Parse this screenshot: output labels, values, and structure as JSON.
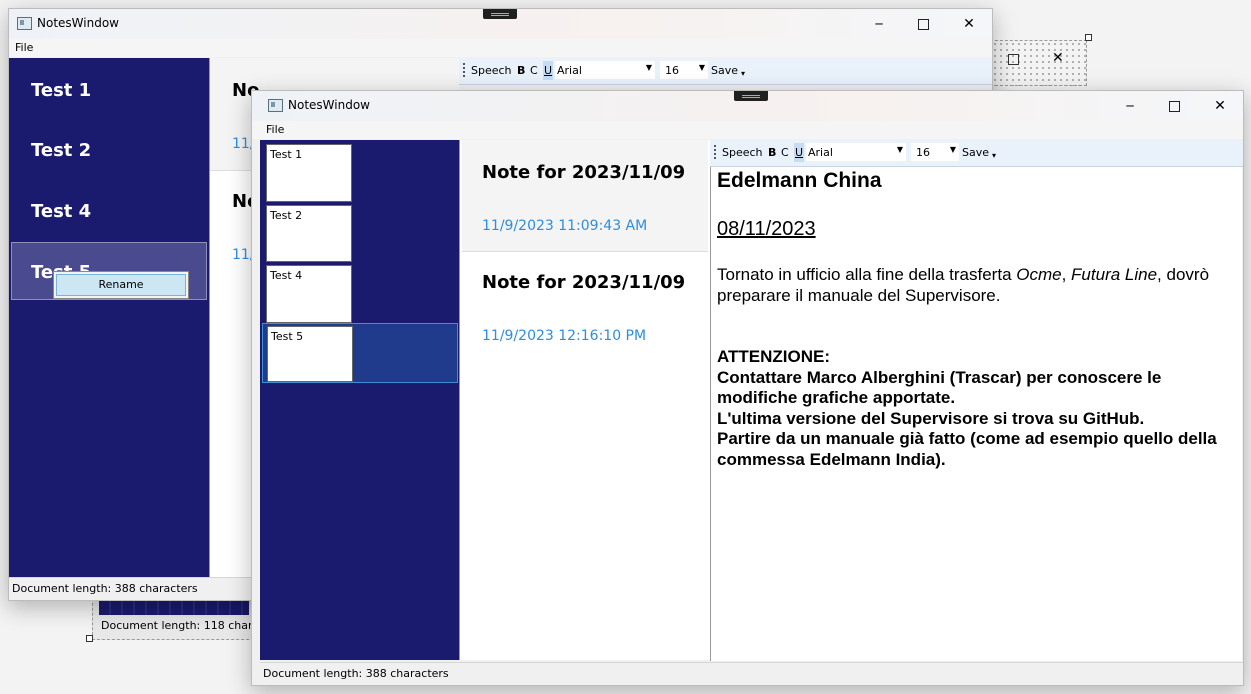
{
  "back_window": {
    "title": "NotesWindow",
    "menu": "File",
    "sidebar_items": [
      "Test 1",
      "Test 2",
      "Test 4",
      "Test 5"
    ],
    "context_menu_item": "Rename",
    "note_title_partial": "No",
    "note_date_partial": "11/",
    "status": "Document length: 388 characters",
    "toolbar": {
      "speech": "Speech",
      "bold": "B",
      "c": "C",
      "underline": "U",
      "font": "Arial",
      "size": "16",
      "save": "Save"
    },
    "behind_status": "Document length: 118 chara"
  },
  "front_window": {
    "title": "NotesWindow",
    "menu": "File",
    "thumbnails": [
      "Test 1",
      "Test 2",
      "Test 4",
      "Test 5"
    ],
    "selected_thumbnail": "Test 5",
    "notes": [
      {
        "title": "Note for 2023/11/09",
        "date": "11/9/2023 11:09:43 AM"
      },
      {
        "title": "Note for 2023/11/09",
        "date": "11/9/2023 12:16:10 PM"
      }
    ],
    "toolbar": {
      "speech": "Speech",
      "bold": "B",
      "c": "C",
      "underline": "U",
      "font": "Arial",
      "size": "16",
      "save": "Save"
    },
    "document": {
      "heading": "Edelmann China",
      "date": "08/11/2023",
      "para_a": "Tornato in ufficio alla fine della trasferta ",
      "para_italic1": "Ocme",
      "para_b": ", ",
      "para_italic2": "Futura Line",
      "para_c": ", dovrò preparare il manuale del Supervisore.",
      "bold_lines": [
        "ATTENZIONE:",
        "Contattare Marco Alberghini (Trascar) per conoscere le modifiche grafiche apportate.",
        "L'ultima versione del Supervisore si trova su GitHub.",
        "Partire da un manuale già fatto (come ad esempio quello della commessa Edelmann India)."
      ]
    },
    "status": "Document length: 388 characters"
  },
  "colors": {
    "sidebar": "#1a1a6e",
    "date_blue": "#2f8ddc",
    "selection": "#203a8c"
  }
}
